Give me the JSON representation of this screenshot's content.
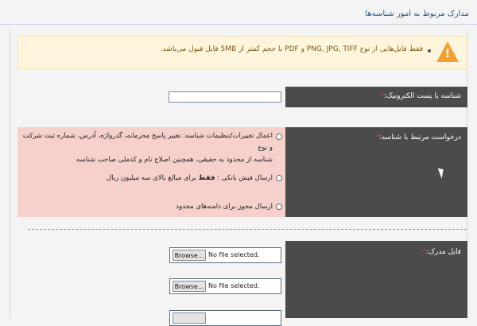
{
  "page": {
    "title": "مدارک مربوط به امور شناسه‌ها"
  },
  "notice": {
    "text": "فقط فایل‌هایی از نوع PNG, JPG, TIFF و PDF با حجم کمتر از 5MB قابل قبول می‌باشد.",
    "icon": "warning-icon"
  },
  "form": {
    "id_label": "شناسه یا پست الکترونیک:",
    "id_value": "",
    "request_label": "درخواست مرتبط با شناسه:",
    "options": [
      {
        "line1": "اعمال تغییرات/تنظیمات شناسه: تغییر پاسخ محرمانه، گذرواژه، آدرس، شماره ثبت شرکت و نوع",
        "line2": "شناسه از محدود به حقیقی، همچنین اصلاح نام و کدملی صاحب شناسه"
      },
      {
        "prefix": "ارسال فیش بانکی :",
        "bold": "فقط",
        "suffix": "برای مبالغ بالای سه میلیون ریال"
      },
      {
        "text": "ارسال مجوز برای دامنه‌های محدود"
      }
    ],
    "file_label": "فایل مدرک:",
    "browse_label": "Browse...",
    "no_file_text": "No file selected."
  },
  "colors": {
    "accent": "#2a5d8a",
    "label_bg": "#4b4b4b",
    "notice_bg": "#fff5dc",
    "request_bg": "#f6d0cb",
    "required": "#e53935"
  }
}
